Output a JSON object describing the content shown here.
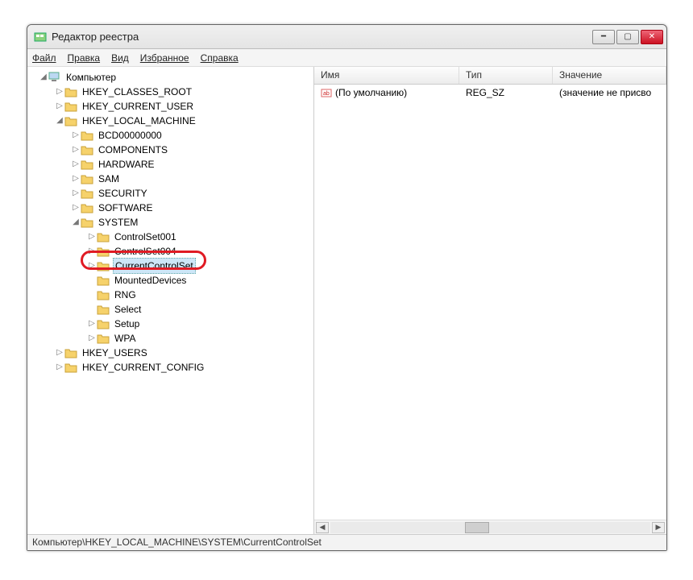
{
  "window": {
    "title": "Редактор реестра"
  },
  "menubar": {
    "file": "Файл",
    "edit": "Правка",
    "view": "Вид",
    "favorites": "Избранное",
    "help": "Справка"
  },
  "tree": {
    "root": "Компьютер",
    "hives": {
      "classes_root": "HKEY_CLASSES_ROOT",
      "current_user": "HKEY_CURRENT_USER",
      "local_machine": "HKEY_LOCAL_MACHINE",
      "users": "HKEY_USERS",
      "current_config": "HKEY_CURRENT_CONFIG"
    },
    "hklm": {
      "bcd": "BCD00000000",
      "components": "COMPONENTS",
      "hardware": "HARDWARE",
      "sam": "SAM",
      "security": "SECURITY",
      "software": "SOFTWARE",
      "system": "SYSTEM"
    },
    "system": {
      "cs001": "ControlSet001",
      "cs004": "ControlSet004",
      "currentcontrolset": "CurrentControlSet",
      "mounteddevices": "MountedDevices",
      "rng": "RNG",
      "select": "Select",
      "setup": "Setup",
      "wpa": "WPA"
    }
  },
  "list": {
    "columns": {
      "name": "Имя",
      "type": "Тип",
      "value": "Значение"
    },
    "rows": [
      {
        "name": "(По умолчанию)",
        "type": "REG_SZ",
        "value": "(значение не присво"
      }
    ]
  },
  "statusbar": {
    "path": "Компьютер\\HKEY_LOCAL_MACHINE\\SYSTEM\\CurrentControlSet"
  }
}
